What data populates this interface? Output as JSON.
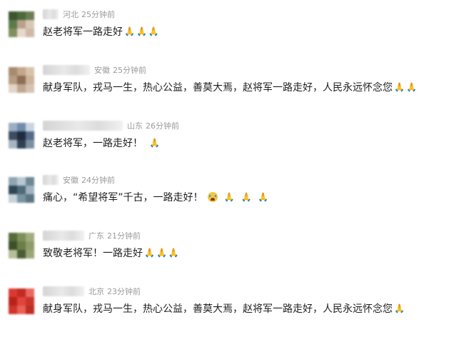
{
  "comments": [
    {
      "location": "河北",
      "time": "25分钟前",
      "text": "赵老将军一路走好",
      "emojis": [
        "🙏",
        "🙏",
        "🙏"
      ],
      "emoji_style": "tight",
      "avatar": [
        "#3d5531",
        "#4a6a3a",
        "#6b7d52",
        "#5c7a48",
        "#b8a28c",
        "#d9c7b6",
        "#7f8f5e",
        "#e8d8cb",
        "#cfb9a6"
      ]
    },
    {
      "location": "安徽",
      "time": "25分钟前",
      "text": "献身军队，戎马一生，热心公益，善莫大焉，赵将军一路走好，人民永远怀念您",
      "emojis": [
        "🙏",
        "🙏"
      ],
      "emoji_style": "tight",
      "avatar": [
        "#a68b6e",
        "#c4a68a",
        "#d9c2ab",
        "#b79d82",
        "#8c6f56",
        "#cdb39a",
        "#e2d4c6",
        "#bfa78f",
        "#d5c3b2"
      ]
    },
    {
      "location": "山东",
      "time": "26分钟前",
      "text": "赵老将军，一路走好！",
      "emojis": [
        "🙏"
      ],
      "emoji_style": "gap",
      "avatar": [
        "#9aaec4",
        "#6f8cab",
        "#c9d4df",
        "#3d4c60",
        "#1f2c3d",
        "#556b87",
        "#a7b5c3",
        "#2f3f55",
        "#7b8ea4"
      ]
    },
    {
      "location": "安徽",
      "time": "24分钟前",
      "text": "痛心，“希望将军”千古，一路走好！",
      "emojis": [
        "😭",
        "🙏",
        "🙏",
        "🙏"
      ],
      "emoji_style": "gap",
      "avatar": [
        "#8fa5b4",
        "#b8c8d2",
        "#6d8795",
        "#2f4655",
        "#4f6a7a",
        "#a0b3bf",
        "#c5d2d9",
        "#7a93a1",
        "#5d7583"
      ]
    },
    {
      "location": "广东",
      "time": "21分钟前",
      "text": "致敬老将军！一路走好",
      "emojis": [
        "🙏",
        "🙏",
        "🙏"
      ],
      "emoji_style": "tight",
      "avatar": [
        "#556b3a",
        "#7d8f5a",
        "#a1ad7e",
        "#3d4f2a",
        "#6c7e48",
        "#8e9c6a",
        "#b7bf98",
        "#4a5d33",
        "#9aa676"
      ]
    },
    {
      "location": "北京",
      "time": "23分钟前",
      "text": "献身军队，戎马一生，热心公益，善莫大焉，赵将军一路走好，人民永远怀念您",
      "emojis": [
        "🙏"
      ],
      "emoji_style": "tight",
      "avatar": [
        "#d93a30",
        "#c22a22",
        "#e46a5f",
        "#b82318",
        "#e0443a",
        "#c9352b",
        "#d0342a",
        "#e86255",
        "#bf2c22"
      ]
    }
  ]
}
